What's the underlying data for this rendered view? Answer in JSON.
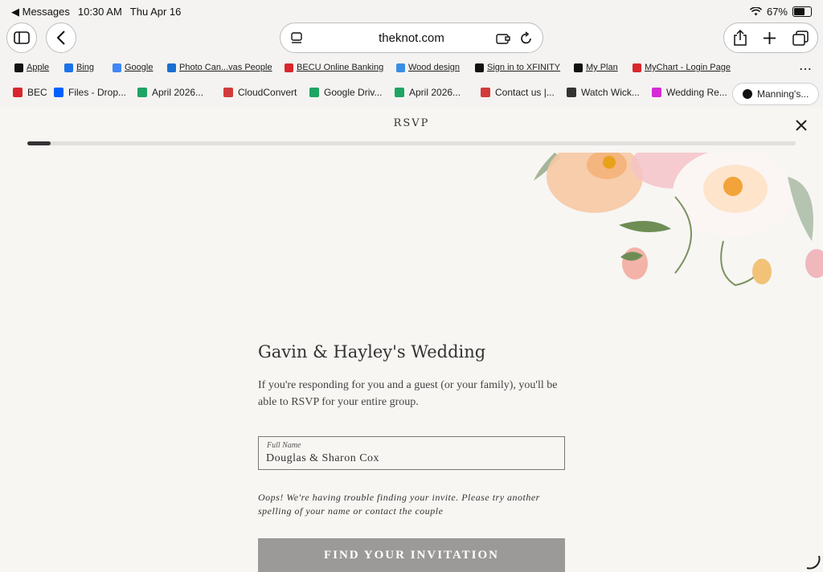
{
  "status_bar": {
    "back_app": "◀ Messages",
    "time": "10:30 AM",
    "date": "Thu Apr 16",
    "battery": "67%",
    "battery_level": 0.67
  },
  "browser": {
    "url": "theknot.com",
    "bookmarks": [
      {
        "label": "Apple",
        "icon": "apple-icon",
        "color": "#111111"
      },
      {
        "label": "Bing",
        "icon": "search-icon",
        "color": "#1a73e8"
      },
      {
        "label": "Google",
        "icon": "google-icon",
        "color": "#4285f4"
      },
      {
        "label": "Photo Can...vas People",
        "icon": "photo-canvas-icon",
        "color": "#1a6fd0"
      },
      {
        "label": "BECU Online Banking",
        "icon": "becu-icon",
        "color": "#d9262c"
      },
      {
        "label": "Wood design",
        "icon": "globe-icon",
        "color": "#3a8ee6"
      },
      {
        "label": "Sign in to XFINITY",
        "icon": "xfinity-icon",
        "color": "#111111"
      },
      {
        "label": "My Plan",
        "icon": "xfinity-icon",
        "color": "#111111"
      },
      {
        "label": "MyChart - Login Page",
        "icon": "mychart-icon",
        "color": "#d9262c"
      }
    ],
    "tabs": [
      {
        "label": "BEC",
        "icon": "becu-icon",
        "color": "#d9262c"
      },
      {
        "label": "Files - Drop...",
        "icon": "dropbox-icon",
        "color": "#0061fe"
      },
      {
        "label": "April 2026...",
        "icon": "google-drive-icon",
        "color": "#1fa463"
      },
      {
        "label": "CloudConvert",
        "icon": "cloud-icon",
        "color": "#d23b3b"
      },
      {
        "label": "Google Driv...",
        "icon": "google-drive-icon",
        "color": "#1fa463"
      },
      {
        "label": "April 2026...",
        "icon": "google-drive-icon",
        "color": "#1fa463"
      },
      {
        "label": "Contact us |...",
        "icon": "cloud-icon",
        "color": "#d23b3b"
      },
      {
        "label": "Watch Wick...",
        "icon": "globe-icon",
        "color": "#333333"
      },
      {
        "label": "Wedding Re...",
        "icon": "knot-icon",
        "color": "#d62bd6"
      },
      {
        "label": "Manning's...",
        "icon": "close-icon",
        "color": "#111111"
      }
    ]
  },
  "page": {
    "title": "RSVP",
    "progress": 0.03,
    "heading": "Gavin & Hayley's Wedding",
    "intro": "If you're responding for you and a guest (or your family), you'll be able to RSVP for your entire group.",
    "name_field": {
      "label": "Full Name",
      "value": "Douglas & Sharon Cox"
    },
    "error": "Oops! We're having trouble finding your invite. Please try another spelling of your name or contact the couple",
    "find_button": "FIND YOUR INVITATION"
  }
}
